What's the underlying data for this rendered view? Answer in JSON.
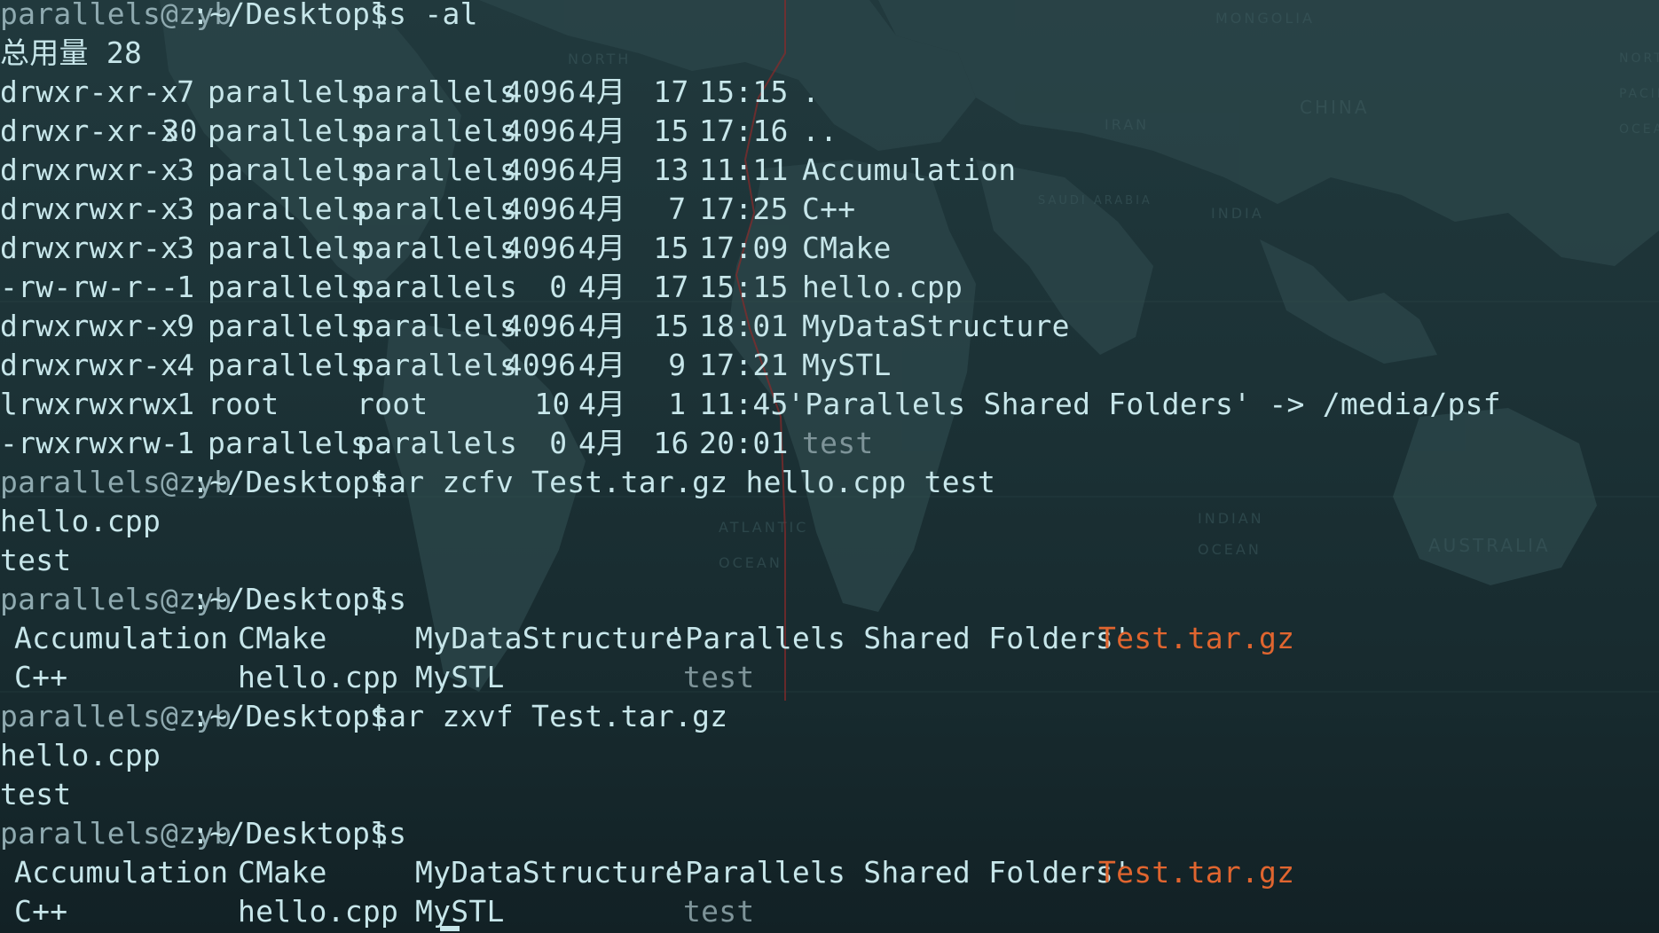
{
  "terminal": {
    "colors": {
      "background": "#1d3539",
      "text": "#c7e6ea",
      "prompt_user": "#8faab0",
      "archive": "#e0652f",
      "dim_file": "#7e9499"
    },
    "prompt": {
      "user_host": "parallels@zyb",
      "path": ":~/Desktop$"
    },
    "commands": [
      {
        "text": "ls -al"
      },
      {
        "text": "tar zcfv Test.tar.gz hello.cpp test"
      },
      {
        "text": "ls"
      },
      {
        "text": "tar zxvf Test.tar.gz"
      },
      {
        "text": "ls"
      }
    ],
    "total_line": "总用量 28",
    "listing": [
      {
        "perms": "drwxr-xr-x",
        "links": "7",
        "owner": "parallels",
        "group": "parallels",
        "size": "4096",
        "month": "4月",
        "day": "17",
        "time": "15:15",
        "name": "."
      },
      {
        "perms": "drwxr-xr-x",
        "links": "30",
        "owner": "parallels",
        "group": "parallels",
        "size": "4096",
        "month": "4月",
        "day": "15",
        "time": "17:16",
        "name": ".."
      },
      {
        "perms": "drwxrwxr-x",
        "links": "3",
        "owner": "parallels",
        "group": "parallels",
        "size": "4096",
        "month": "4月",
        "day": "13",
        "time": "11:11",
        "name": "Accumulation"
      },
      {
        "perms": "drwxrwxr-x",
        "links": "3",
        "owner": "parallels",
        "group": "parallels",
        "size": "4096",
        "month": "4月",
        "day": "7",
        "time": "17:25",
        "name": "C++"
      },
      {
        "perms": "drwxrwxr-x",
        "links": "3",
        "owner": "parallels",
        "group": "parallels",
        "size": "4096",
        "month": "4月",
        "day": "15",
        "time": "17:09",
        "name": "CMake"
      },
      {
        "perms": "-rw-rw-r--",
        "links": "1",
        "owner": "parallels",
        "group": "parallels",
        "size": "0",
        "month": "4月",
        "day": "17",
        "time": "15:15",
        "name": "hello.cpp"
      },
      {
        "perms": "drwxrwxr-x",
        "links": "9",
        "owner": "parallels",
        "group": "parallels",
        "size": "4096",
        "month": "4月",
        "day": "15",
        "time": "18:01",
        "name": "MyDataStructure"
      },
      {
        "perms": "drwxrwxr-x",
        "links": "4",
        "owner": "parallels",
        "group": "parallels",
        "size": "4096",
        "month": "4月",
        "day": "9",
        "time": "17:21",
        "name": "MySTL"
      },
      {
        "perms": "lrwxrwxrwx",
        "links": "1",
        "owner": "root",
        "group": "root",
        "size": "10",
        "month": "4月",
        "day": "1",
        "time": "11:45",
        "name": "'Parallels Shared Folders' -> /media/psf"
      },
      {
        "perms": "-rwxrwxrw-",
        "links": "1",
        "owner": "parallels",
        "group": "parallels",
        "size": "0",
        "month": "4月",
        "day": "16",
        "time": "20:01",
        "name": "test"
      }
    ],
    "tar_create_output": [
      "hello.cpp",
      "test"
    ],
    "tar_extract_output": [
      "hello.cpp",
      "test"
    ],
    "ls_grid": {
      "row1": [
        "Accumulation",
        "CMake",
        "MyDataStructure",
        "'Parallels Shared Folders'",
        "Test.tar.gz"
      ],
      "row2": [
        "C++",
        "hello.cpp",
        "MySTL",
        "test"
      ]
    },
    "background_map_labels": [
      "MONGOLIA",
      "CHINA",
      "IRAN",
      "INDIA",
      "SAUDI ARABIA",
      "INDIAN OCEAN",
      "AUSTRALIA",
      "ATLANTIC OCEAN",
      "NORTH"
    ]
  }
}
